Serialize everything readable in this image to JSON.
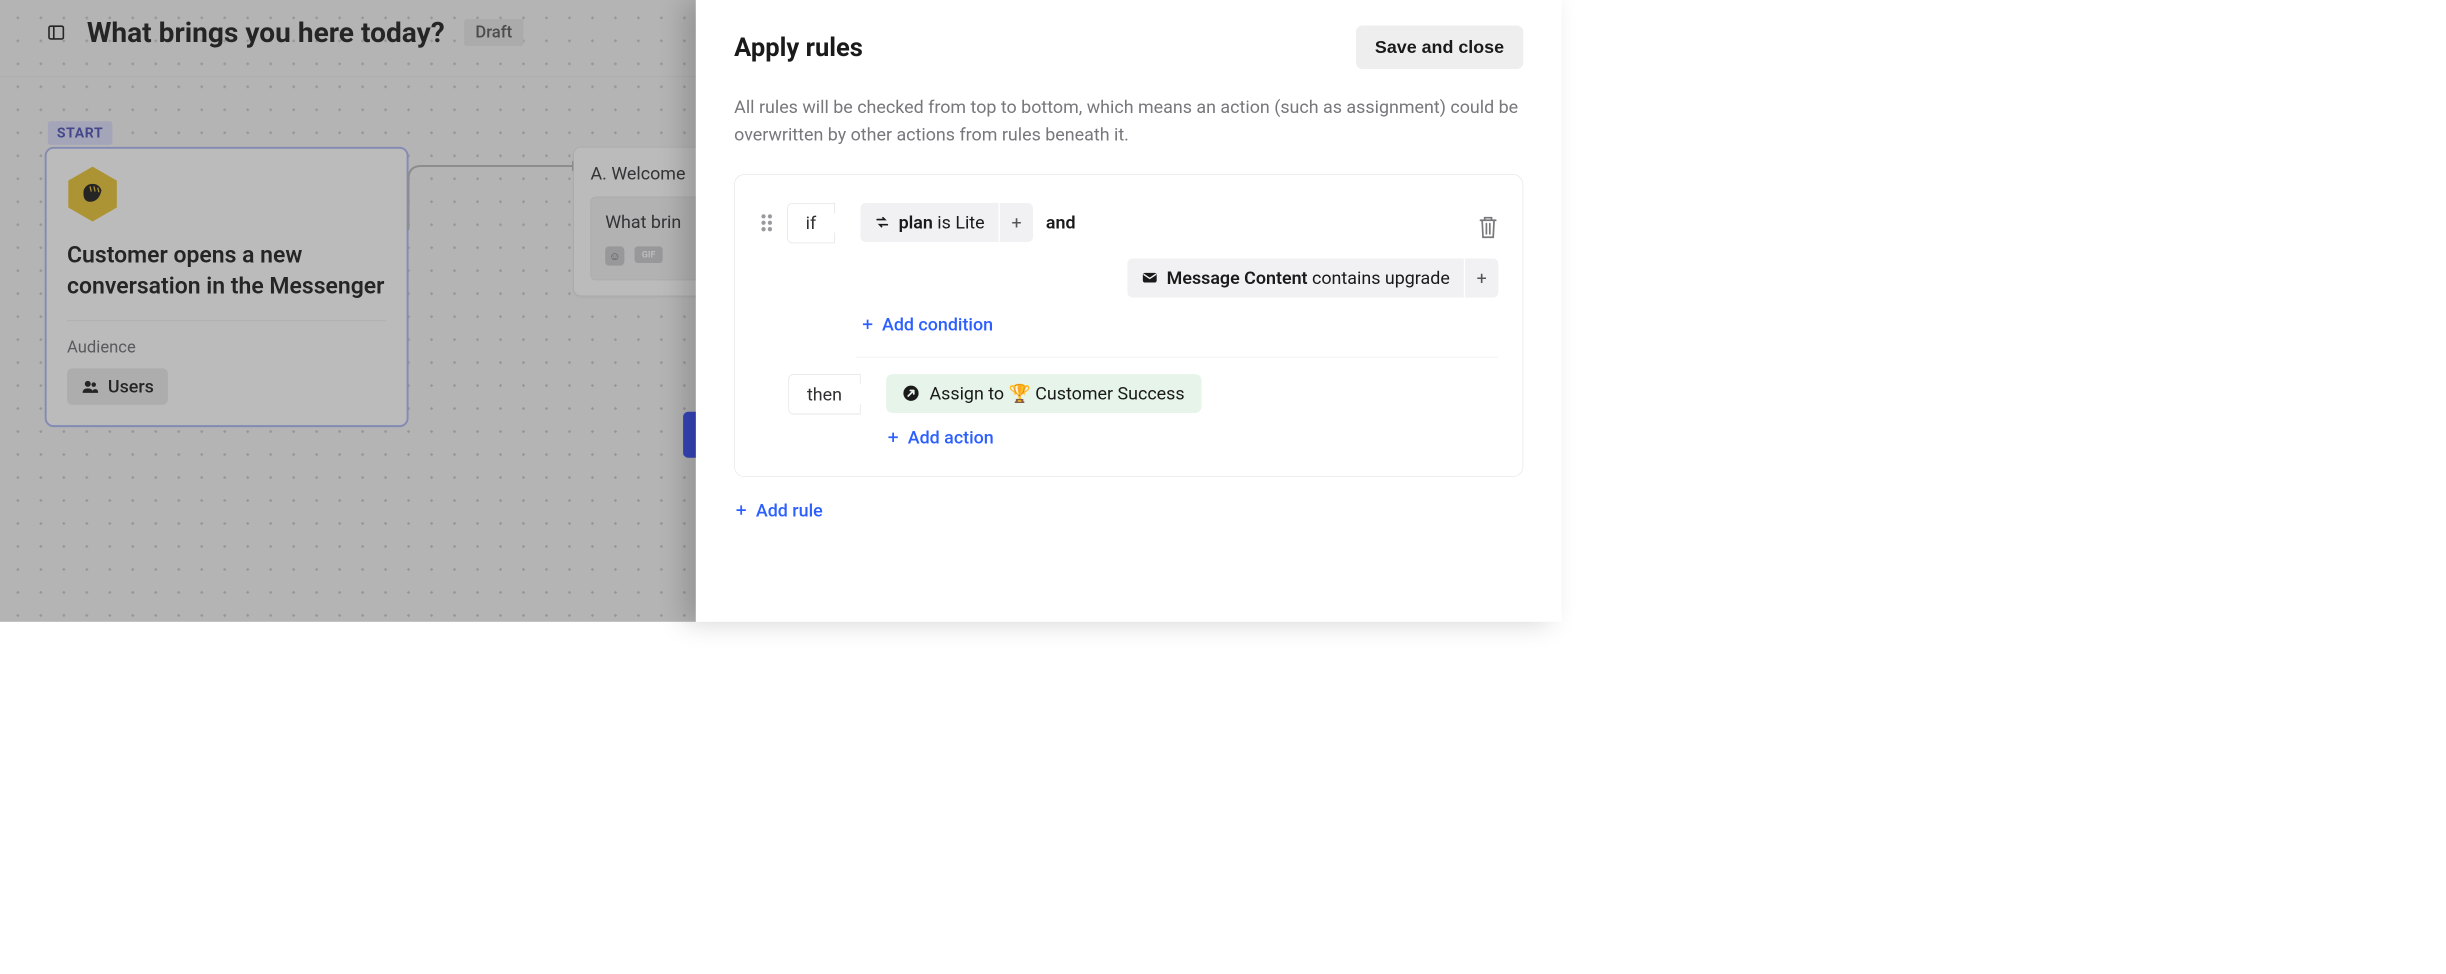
{
  "header": {
    "title": "What brings you here today?",
    "status": "Draft"
  },
  "flow": {
    "start_label": "START",
    "start_card_title": "Customer opens a new conversation in the Messenger",
    "audience_label": "Audience",
    "audience_value": "Users",
    "welcome_title": "A. Welcome",
    "welcome_text": "What brin",
    "gif_label": "GIF"
  },
  "drawer": {
    "title": "Apply rules",
    "save_label": "Save and close",
    "description": "All rules will be checked from top to bottom, which means an action (such as assignment) could be overwritten by other actions from rules beneath it.",
    "if_label": "if",
    "then_label": "then",
    "and_label": "and",
    "condition1_attr": "plan",
    "condition1_op": "is",
    "condition1_val": "Lite",
    "condition2_attr": "Message Content",
    "condition2_op": "contains",
    "condition2_val": "upgrade",
    "add_condition": "Add condition",
    "action_prefix": "Assign to",
    "action_team": "Customer Success",
    "add_action": "Add action",
    "add_rule": "Add rule"
  }
}
